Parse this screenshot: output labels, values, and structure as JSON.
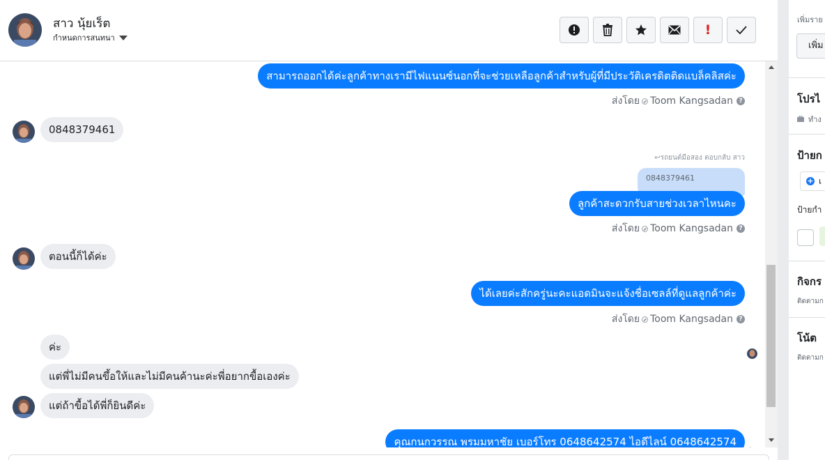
{
  "header": {
    "contact_name": "สาว นุ้ยเร็ต",
    "assign_label": "กำหนดการสนทนา",
    "toolbar": [
      {
        "name": "spam-button",
        "icon": "alert-circle-icon"
      },
      {
        "name": "delete-button",
        "icon": "trash-icon"
      },
      {
        "name": "star-button",
        "icon": "star-icon"
      },
      {
        "name": "mark-unread-button",
        "icon": "envelope-icon"
      },
      {
        "name": "follow-up-button",
        "icon": "exclamation-icon"
      },
      {
        "name": "done-button",
        "icon": "checkmark-icon"
      }
    ]
  },
  "thread": {
    "msg1": "สามารถออกได้ค่ะลูกค้าทางเรามีไฟแนนซ์นอกที่จะช่วยเหลือลูกค้าสำหรับผู้ที่มีประวัติเครดิตติดแบล็คลิสค่ะ",
    "sent_by_prefix": "ส่งโดย",
    "sender": "Toom Kangsadan",
    "msg2": "0848379461",
    "reply_note": "รถยนต์มือสอง ตอบกลับ สาว",
    "quote": "0848379461",
    "msg3": "ลูกค้าสะดวกรับสายช่วงเวลาไหนคะ",
    "msg4": "ตอนนี้ก็ได้ค่ะ",
    "msg5": "ได้เลยค่ะสักครู่นะคะแอดมินจะแจ้งชื่อเซลล์ที่ดูแลลูกค้าค่ะ",
    "msg6": "ค่ะ",
    "msg7": "แต่พี่ไม่มีคนขึ้อให้และไม่มีคนค้านะค่ะพี่อยากขื้อเองค่ะ",
    "msg8": "แต่ถ้าขื้อได้พี่ก็ยินดีค่ะ",
    "msg9": "คุณกนกวรรณ พรมมหาชัย     เบอร์โทร 0648642574  ไอดีไลน์ 0648642574"
  },
  "right_panel": {
    "add_detail_label": "เพิ่มราย",
    "add_button": "เพิ่ม",
    "profile_title": "โปรไ",
    "profile_sub": "ทำง",
    "tags_title": "ป้ายก",
    "tag_add_btn": "เ",
    "tags_sub": "ป้ายกำ",
    "activity_title": "กิจกร",
    "activity_sub": "ติดตามก",
    "notes_title": "โน้ต",
    "notes_sub": "ติดตามก"
  },
  "colors": {
    "outgoing_bubble": "#0a7cff",
    "incoming_bubble": "#ebedf0",
    "alert_red": "#e02020"
  }
}
